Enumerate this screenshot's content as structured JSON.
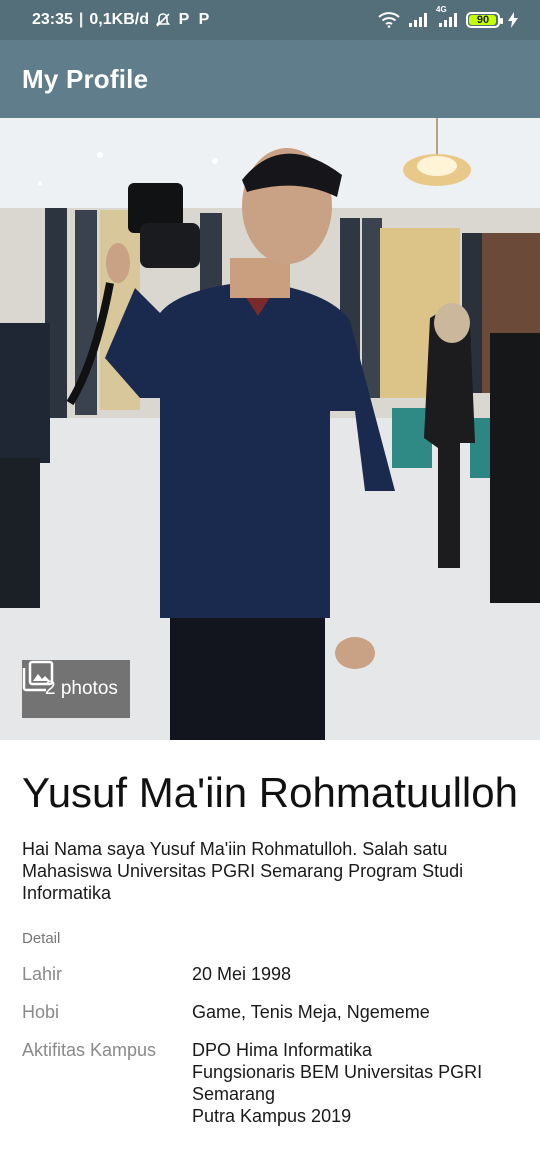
{
  "status_bar": {
    "time": "23:35",
    "speed": "0,1KB/d",
    "battery_level": "90",
    "network": "4G",
    "icons": [
      "mute-bell-icon",
      "parking-icon",
      "parking-icon",
      "wifi-icon",
      "signal-icon",
      "signal-4g-icon",
      "battery-icon",
      "charging-bolt-icon"
    ]
  },
  "app_bar": {
    "title": "My Profile"
  },
  "photo": {
    "count_label": "2 photos",
    "icon": "gallery-icon"
  },
  "profile": {
    "name": "Yusuf Ma'iin Rohmatuulloh",
    "bio": "Hai Nama saya Yusuf Ma'iin Rohmatulloh. Salah satu Mahasiswa Universitas PGRI Semarang Program Studi Informatika",
    "detail_heading": "Detail",
    "details": [
      {
        "label": "Lahir",
        "value": "20 Mei 1998"
      },
      {
        "label": "Hobi",
        "value": "Game, Tenis Meja, Ngememe"
      },
      {
        "label": "Aktifitas Kampus",
        "value": "DPO Hima Informatika\n Fungsionaris BEM Universitas PGRI Semarang\n Putra Kampus 2019"
      }
    ]
  },
  "colors": {
    "status_bar": "#546e7a",
    "app_bar": "#607d8b",
    "battery": "#c6ff00"
  }
}
